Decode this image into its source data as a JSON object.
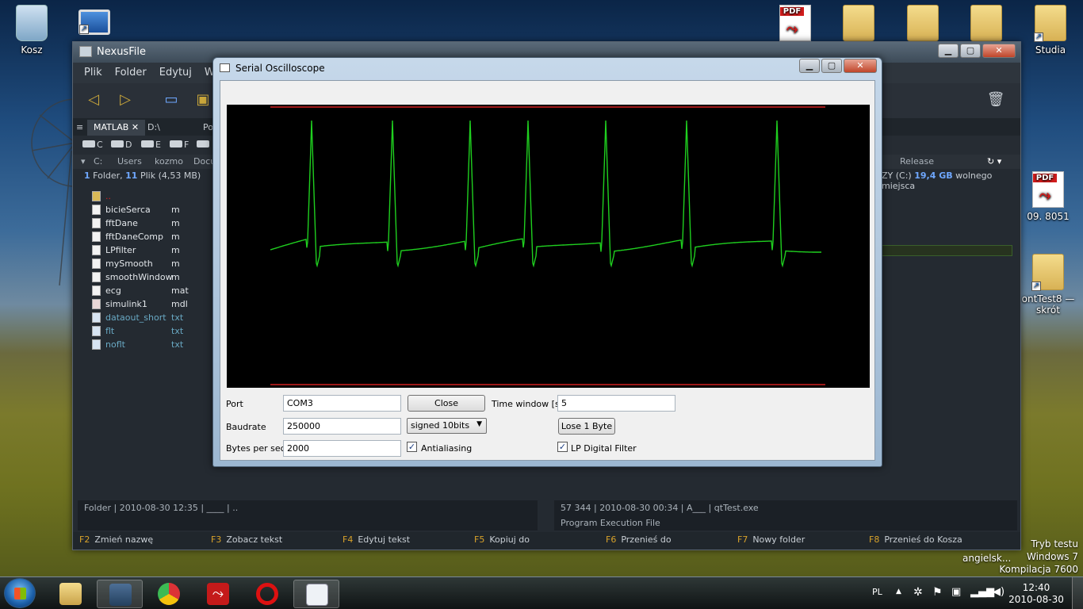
{
  "desktop": {
    "icons": [
      {
        "label": "Kosz"
      },
      {
        "label": ""
      },
      {
        "label": "Studia"
      },
      {
        "label": "09. 8051"
      },
      {
        "label": "ontTest8 —\nskrót"
      }
    ],
    "pdf_word": "PDF",
    "adobe_word": "Adobe",
    "angielsk": "angielsk...",
    "watermark": [
      "Tryb testu",
      "Windows 7",
      "Kompilacja 7600"
    ]
  },
  "nexus": {
    "title": "NexusFile",
    "menu": [
      "Plik",
      "Folder",
      "Edytuj",
      "Wido"
    ],
    "tabs": [
      "MATLAB",
      "D:\\",
      "Po"
    ],
    "drives": [
      "C",
      "D",
      "E",
      "F",
      "G"
    ],
    "breadcrumbs": [
      "C:",
      "Users",
      "kozmo",
      "Docu"
    ],
    "summary": {
      "folders": "1",
      "folder_word": "Folder,",
      "files": "11",
      "file_word": "Plik",
      "size": "(4,53 MB)"
    },
    "right_summary": {
      "prefix": "ZY (C:)",
      "free": "19,4 GB",
      "suffix": "wolnego miejsca"
    },
    "release": "Release",
    "parent_row": "..",
    "files": [
      {
        "name": "bicieSerca",
        "ext": "m"
      },
      {
        "name": "fftDane",
        "ext": "m"
      },
      {
        "name": "fftDaneComp",
        "ext": "m"
      },
      {
        "name": "LPfilter",
        "ext": "m"
      },
      {
        "name": "mySmooth",
        "ext": "m"
      },
      {
        "name": "smoothWindow",
        "ext": "m"
      },
      {
        "name": "ecg",
        "ext": "mat"
      },
      {
        "name": "simulink1",
        "ext": "mdl"
      },
      {
        "name": "dataout_short",
        "ext": "txt"
      },
      {
        "name": "flt",
        "ext": "txt"
      },
      {
        "name": "noflt",
        "ext": "txt"
      }
    ],
    "status_left": "Folder | 2010-08-30 12:35 | ____ | ..",
    "status_right_1": "57 344 | 2010-08-30 00:34 | A___ | qtTest.exe",
    "status_right_2": "Program Execution File",
    "fkeys": [
      {
        "key": "F2",
        "label": "Zmień nazwę"
      },
      {
        "key": "F3",
        "label": "Zobacz tekst"
      },
      {
        "key": "F4",
        "label": "Edytuj tekst"
      },
      {
        "key": "F5",
        "label": "Kopiuj do"
      },
      {
        "key": "F6",
        "label": "Przenieś do"
      },
      {
        "key": "F7",
        "label": "Nowy folder"
      },
      {
        "key": "F8",
        "label": "Przenieś do Kosza"
      }
    ]
  },
  "osc": {
    "title": "Serial Oscilloscope",
    "port_label": "Port",
    "port_value": "COM3",
    "close_button": "Close",
    "time_window_label": "Time window [s]",
    "time_window_value": "5",
    "baudrate_label": "Baudrate",
    "baudrate_value": "250000",
    "format_value": "signed 10bits",
    "lose_byte_button": "Lose 1 Byte",
    "bytes_per_sec_label": "Bytes per sec",
    "bytes_per_sec_value": "2000",
    "antialiasing_label": "Antialiasing",
    "antialiasing_checked": true,
    "lp_filter_label": "LP Digital Filter",
    "lp_filter_checked": true,
    "trace_color": "#1fcf1f",
    "limit_color": "#d02020",
    "beats": 8
  },
  "taskbar": {
    "lang": "PL",
    "time": "12:40",
    "date": "2010-08-30"
  }
}
